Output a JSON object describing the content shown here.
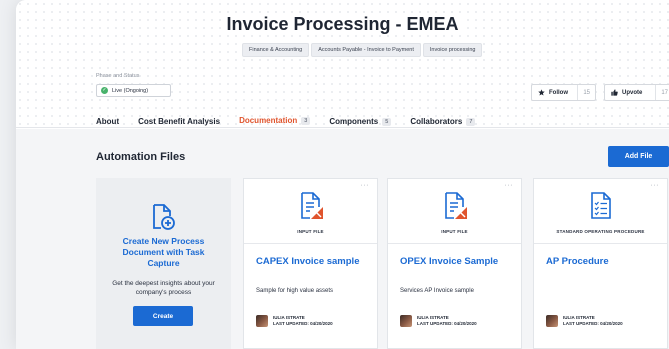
{
  "header": {
    "title": "Invoice Processing - EMEA",
    "tags": [
      "Finance & Accounting",
      "Accounts Payable - Invoice to Payment",
      "Invoice processing"
    ],
    "phase_label": "Phase and Status",
    "status": "Live (Ongoing)",
    "follow": {
      "label": "Follow",
      "count": "15"
    },
    "upvote": {
      "label": "Upvote",
      "count": "17"
    }
  },
  "tabs": [
    {
      "label": "About",
      "badge": ""
    },
    {
      "label": "Cost Benefit Analysis",
      "badge": ""
    },
    {
      "label": "Documentation",
      "badge": "3"
    },
    {
      "label": "Components",
      "badge": "5"
    },
    {
      "label": "Collaborators",
      "badge": "7"
    }
  ],
  "section": {
    "title": "Automation Files",
    "add_file": "Add File"
  },
  "create_card": {
    "title": "Create New Process Document with Task Capture",
    "desc": "Get the deepest insights about your company's process",
    "button": "Create"
  },
  "files": [
    {
      "type": "INPUT FILE",
      "title": "CAPEX Invoice sample",
      "desc": "Sample for high value assets",
      "author": "IULIA ISTRATE",
      "updated": "LAST UPDATED: 04/20/2020"
    },
    {
      "type": "INPUT FILE",
      "title": "OPEX Invoice Sample",
      "desc": "Services AP Invoice sample",
      "author": "IULIA ISTRATE",
      "updated": "LAST UPDATED: 04/20/2020"
    },
    {
      "type": "STANDARD OPERATING PROCEDURE",
      "title": "AP Procedure",
      "desc": "",
      "author": "IULIA ISTRATE",
      "updated": "LAST UPDATED: 04/20/2020"
    }
  ],
  "colors": {
    "accent": "#1b6ad3",
    "active_tab": "#e0542d",
    "live": "#48b26b"
  }
}
